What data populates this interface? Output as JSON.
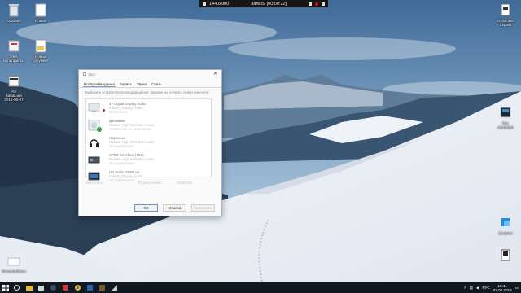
{
  "recorder": {
    "resolution": "1440x900",
    "status": "Запись [00:00:22]"
  },
  "desktop_icons": [
    {
      "label": "Корзина",
      "icon": "recycle-bin-icon"
    },
    {
      "label": "Новый",
      "icon": "text-document-icon"
    },
    {
      "label": "ЕВА\nмультфильм",
      "icon": "file-icon"
    },
    {
      "label": "Новый\nдокумент",
      "icon": "document-icon"
    },
    {
      "label": "AVI\nbandicam\n2015-06-07",
      "icon": "video-file-icon"
    },
    {
      "label": "Установка\nСкрипт",
      "icon": "script-icon"
    },
    {
      "label": "Без\nназвания",
      "icon": "image-icon"
    },
    {
      "label": "Бегунок",
      "icon": "app-icon"
    },
    {
      "label": "",
      "icon": "file-icon"
    },
    {
      "label": "Фотоальбомы",
      "icon": "folder-icon"
    }
  ],
  "dialog": {
    "title": "Звук",
    "tabs": [
      "Воспроизведение",
      "Запись",
      "Звуки",
      "Связь"
    ],
    "description": "Выберите устройство воспроизведения, параметры которого нужно изменить:",
    "devices": [
      {
        "name": "4 - Digital Display Audio",
        "sub": "Intel(R) Display Audio",
        "status": "Отключено",
        "icon": "monitor-icon"
      },
      {
        "name": "Динамики",
        "sub": "Realtek High Definition Audio",
        "status": "Устройство по умолчанию",
        "icon": "speaker-icon"
      },
      {
        "name": "Наушники",
        "sub": "Realtek High Definition Audio",
        "status": "Не подключено",
        "icon": "headphones-icon"
      },
      {
        "name": "SPDIF Interface (TX1)",
        "sub": "Realtek High Definition Audio",
        "status": "Не подключено",
        "icon": "spdif-icon"
      },
      {
        "name": "HD Audio HDMI out",
        "sub": "Intel(R) Display Audio",
        "status": "Не подключено",
        "icon": "hdmi-icon"
      }
    ],
    "lower_buttons": [
      "Настроить",
      "По умолчанию",
      "Свойства"
    ],
    "ok": "ОК",
    "cancel": "Отмена",
    "apply": "Применить"
  },
  "taskbar": {
    "apps": [
      "edge-icon",
      "explorer-icon",
      "store-icon",
      "steam-icon",
      "bandicam-icon",
      "chrome-icon",
      "word-icon",
      "game-icon",
      "media-icon"
    ],
    "language": "РУС",
    "time": "16:41",
    "date": "07.06.2015"
  },
  "colors": {
    "accent": "#6a90c8",
    "taskbar": "#101820",
    "check": "#2e9d3a"
  }
}
